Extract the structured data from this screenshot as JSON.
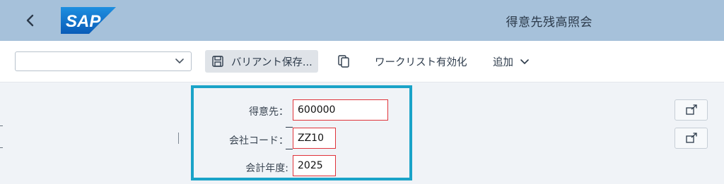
{
  "header": {
    "title": "得意先残高照会",
    "logo_text": "SAP",
    "brand_color": "#1a73c8"
  },
  "toolbar": {
    "variant_value": "",
    "save_variant_label": "バリアント保存...",
    "worklist_label": "ワークリスト有効化",
    "add_label": "追加"
  },
  "form": {
    "customer_label": "得意先：",
    "customer_value": "600000",
    "company_code_label": "会社コード：",
    "company_code_value": "ZZ10",
    "fiscal_year_label": "会計年度:",
    "fiscal_year_value": "2025"
  },
  "colors": {
    "shell_bg": "#a6c1da",
    "highlight_border": "#1aa3c8",
    "error_border": "#e0333a"
  },
  "icons": {
    "back": "chevron-left-icon",
    "save": "save-icon",
    "copy": "copy-icon",
    "dropdown": "chevron-down-icon",
    "external": "open-external-icon"
  }
}
